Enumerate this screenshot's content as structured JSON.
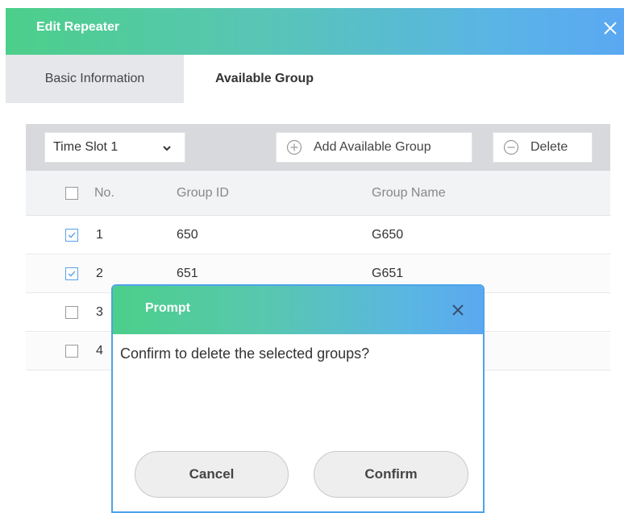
{
  "window": {
    "title": "Edit Repeater"
  },
  "tabs": [
    {
      "label": "Basic Information"
    },
    {
      "label": "Available Group"
    }
  ],
  "toolbar": {
    "time_slot": "Time Slot 1",
    "add_label": "Add Available Group",
    "delete_label": "Delete"
  },
  "table": {
    "headers": [
      "No.",
      "Group ID",
      "Group Name"
    ],
    "rows": [
      {
        "no": "1",
        "group_id": "650",
        "group_name": "G650",
        "checked": true
      },
      {
        "no": "2",
        "group_id": "651",
        "group_name": "G651",
        "checked": true
      },
      {
        "no": "3",
        "group_id": "",
        "group_name": "",
        "checked": false
      },
      {
        "no": "4",
        "group_id": "",
        "group_name": "",
        "checked": false
      }
    ]
  },
  "dialog": {
    "title": "Prompt",
    "message": "Confirm to delete the selected groups?",
    "cancel_label": "Cancel",
    "confirm_label": "Confirm"
  },
  "colors": {
    "gradient_start": "#4ccf8a",
    "gradient_end": "#5aa8f2",
    "checkbox_accent": "#5aa0e6",
    "toolbar_bg": "#d7d9dc"
  },
  "icons": [
    "close-icon",
    "chevron-down-icon",
    "plus-circle-icon",
    "minus-circle-icon",
    "checkbox-icon"
  ]
}
